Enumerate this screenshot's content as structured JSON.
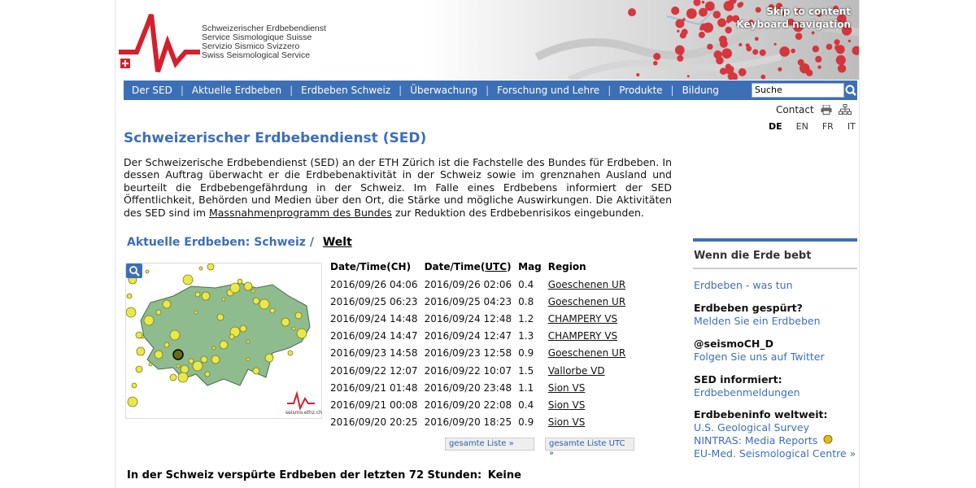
{
  "org": {
    "names": [
      "Schweizerischer Erdbebendienst",
      "Service Sismologique Suisse",
      "Servizio Sismico Svizzero",
      "Swiss Seismological Service"
    ]
  },
  "skip": {
    "content": "Skip to content",
    "keyboard": "Keyboard navigation"
  },
  "nav": {
    "items": [
      "Der SED",
      "Aktuelle Erdbeben",
      "Erdbeben Schweiz",
      "Überwachung",
      "Forschung und Lehre",
      "Produkte",
      "Bildung"
    ],
    "search_value": "Suche"
  },
  "util": {
    "contact": "Contact"
  },
  "languages": [
    "DE",
    "EN",
    "FR",
    "IT"
  ],
  "page": {
    "title": "Schweizerischer Erdbebendienst (SED)",
    "intro_part1": "Der Schweizerische Erdbebendienst (SED) an der ETH Zürich ist die Fachstelle des Bundes für Erdbeben. In dessen Auftrag überwacht er die Erdbebenaktivität in der Schweiz sowie im grenznahen Ausland und beurteilt die Erdbebengefährdung in der Schweiz. Im Falle eines Erdbebens informiert der SED Öffentlichkeit, Behörden und Medien über den Ort, die Stärke und mögliche Auswirkungen. Die Aktivitäten des SED sind im ",
    "intro_link": "Massnahmenprogramm des Bundes",
    "intro_part2": " zur Reduktion des Erdbebenrisikos eingebunden."
  },
  "quakes": {
    "heading_prefix": "Aktuelle Erdbeben:",
    "tab_schweiz": "Schweiz /",
    "tab_welt": "Welt",
    "col_ch": "Date/Time(CH)",
    "col_utc_prefix": "Date/Time(",
    "col_utc_unit": "UTC",
    "col_utc_suffix": ")",
    "col_mag": "Mag",
    "col_region": "Region",
    "rows": [
      [
        "2016/09/26 04:06",
        "2016/09/26 02:06",
        "0.4",
        "Goeschenen UR"
      ],
      [
        "2016/09/25 06:23",
        "2016/09/25 04:23",
        "0.8",
        "Goeschenen UR"
      ],
      [
        "2016/09/24 14:48",
        "2016/09/24 12:48",
        "1.2",
        "CHAMPERY VS"
      ],
      [
        "2016/09/24 14:47",
        "2016/09/24 12:47",
        "1.3",
        "CHAMPERY VS"
      ],
      [
        "2016/09/23 14:58",
        "2016/09/23 12:58",
        "0.9",
        "Goeschenen UR"
      ],
      [
        "2016/09/22 12:07",
        "2016/09/22 10:07",
        "1.5",
        "Vallorbe VD"
      ],
      [
        "2016/09/21 01:48",
        "2016/09/20 23:48",
        "1.1",
        "Sion VS"
      ],
      [
        "2016/09/21 00:08",
        "2016/09/20 22:08",
        "0.4",
        "Sion VS"
      ],
      [
        "2016/09/20 20:25",
        "2016/09/20 18:25",
        "0.9",
        "Sion VS"
      ]
    ],
    "btn_list": "gesamte Liste »",
    "btn_list_utc": "gesamte Liste UTC »",
    "map_credit": "seismo.ethz.ch",
    "felt_label": "In der Schweiz verspürte Erdbeben der letzten 72 Stunden:",
    "felt_value": "Keine"
  },
  "sidebar": {
    "title": "Wenn die Erde bebt",
    "link1": "Erdbeben - was tun",
    "head2": "Erdbeben gespürt?",
    "link2": "Melden Sie ein Erdbeben",
    "head3": "@seismoCH_D",
    "link3": "Folgen Sie uns auf Twitter",
    "head4": "SED informiert:",
    "link4": "Erdbebenmeldungen",
    "head5": "Erdbebeninfo weltweit:",
    "link5a": "U.S. Geological Survey",
    "link5b": "NINTRAS: Media Reports",
    "link5c": "EU-Med. Seismological Centre »"
  },
  "colors": {
    "brand_blue": "#3d6fb6",
    "logo_red": "#d3202e"
  }
}
